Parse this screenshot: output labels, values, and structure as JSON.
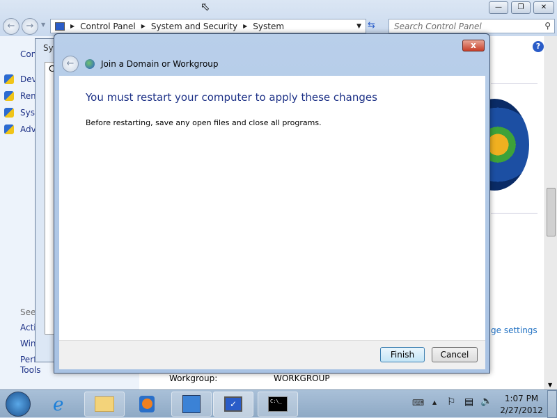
{
  "explorer": {
    "breadcrumb": [
      "Control Panel",
      "System and Security",
      "System"
    ],
    "search_placeholder": "Search Control Panel",
    "left_pane": {
      "top": "Con",
      "tasks": [
        "Dev",
        "Rem",
        "Syst",
        "Adv"
      ],
      "see_also": "See",
      "links": [
        "Acti",
        "Win",
        "Perf",
        "Tools"
      ]
    },
    "right_link": "ge settings",
    "workgroup_label": "Workgroup:",
    "workgroup_value": "WORKGROUP"
  },
  "sysprop": {
    "title": "Sys",
    "tab": "C"
  },
  "dialog": {
    "title": "Join a Domain or Workgroup",
    "heading": "You must restart your computer to apply these changes",
    "message": "Before restarting, save any open files and close all programs.",
    "finish": "Finish",
    "cancel": "Cancel",
    "close": "x"
  },
  "taskbar": {
    "time": "1:07 PM",
    "date": "2/27/2012",
    "apps": [
      "start-orb",
      "internet-explorer",
      "windows-explorer",
      "media-player",
      "control-panel",
      "remote-desktop",
      "command-prompt"
    ]
  },
  "colors": {
    "heading": "#1e3287",
    "link": "#1e6fc2",
    "close": "#c7402a"
  }
}
